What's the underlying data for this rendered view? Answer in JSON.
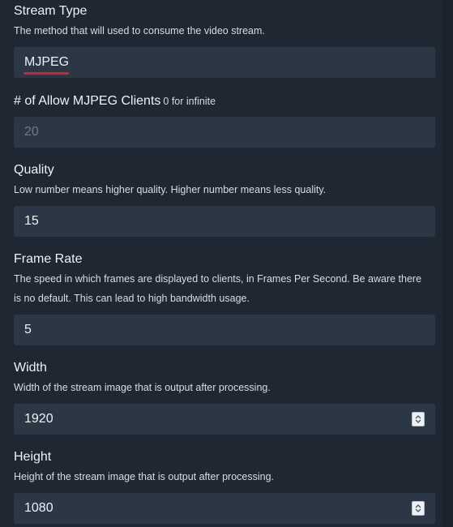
{
  "fields": {
    "stream_type": {
      "label": "Stream Type",
      "description": "The method that will used to consume the video stream.",
      "value": "MJPEG"
    },
    "allow_clients": {
      "label": "# of Allow MJPEG Clients",
      "hint": "0 for infinite",
      "value": "20"
    },
    "quality": {
      "label": "Quality",
      "description": "Low number means higher quality. Higher number means less quality.",
      "value": "15"
    },
    "frame_rate": {
      "label": "Frame Rate",
      "description_line1": "The speed in which frames are displayed to clients, in Frames Per Second. Be aware there",
      "description_line2": "is no default. This can lead to high bandwidth usage.",
      "value": "5"
    },
    "width": {
      "label": "Width",
      "description": "Width of the stream image that is output after processing.",
      "value": "1920"
    },
    "height": {
      "label": "Height",
      "description": "Height of the stream image that is output after processing.",
      "value": "1080"
    }
  },
  "colors": {
    "background": "#1f2733",
    "input_background": "#2b3745",
    "spellcheck_underline": "#d3262c"
  },
  "icons": {
    "spinner": "up-down-spinner-icon"
  }
}
